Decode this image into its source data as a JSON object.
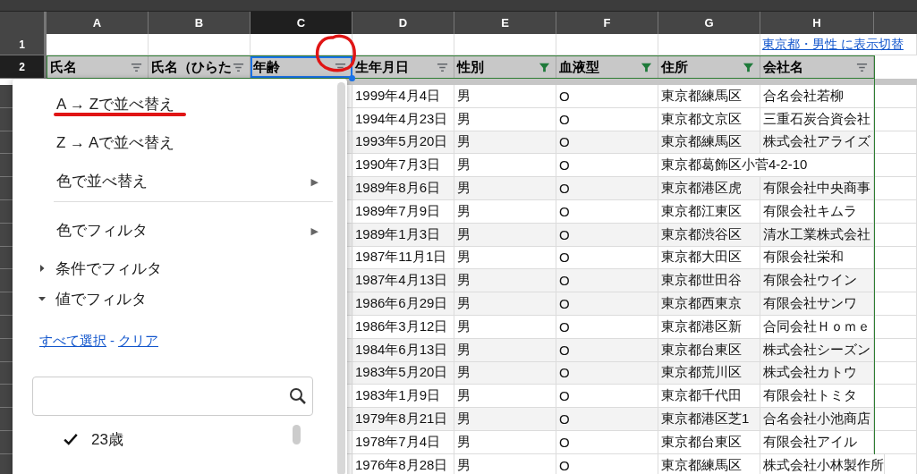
{
  "columns": [
    {
      "letter": "A",
      "selected": false,
      "header": "氏名",
      "filter_active": false
    },
    {
      "letter": "B",
      "selected": false,
      "header": "氏名（ひらた",
      "filter_active": false
    },
    {
      "letter": "C",
      "selected": true,
      "header": "年齢",
      "filter_active": false
    },
    {
      "letter": "D",
      "selected": false,
      "header": "生年月日",
      "filter_active": false
    },
    {
      "letter": "E",
      "selected": false,
      "header": "性別",
      "filter_active": true
    },
    {
      "letter": "F",
      "selected": false,
      "header": "血液型",
      "filter_active": true
    },
    {
      "letter": "G",
      "selected": false,
      "header": "住所",
      "filter_active": true
    },
    {
      "letter": "H",
      "selected": false,
      "header": "会社名",
      "filter_active": false
    }
  ],
  "row_numbers": [
    {
      "label": "1",
      "selected": false
    },
    {
      "label": "2",
      "selected": true
    }
  ],
  "link": "東京都・男性 に表示切替",
  "rows": [
    {
      "shaded": false,
      "cells": [
        "1999年4月4日",
        "男",
        "O",
        "東京都練馬区",
        "合名会社若柳"
      ]
    },
    {
      "shaded": false,
      "cells": [
        "1994年4月23日",
        "男",
        "O",
        "東京都文京区",
        "三重石炭合資会社"
      ]
    },
    {
      "shaded": true,
      "cells": [
        "1993年5月20日",
        "男",
        "O",
        "東京都練馬区",
        "株式会社アライズ"
      ]
    },
    {
      "shaded": false,
      "cells": [
        "1990年7月3日",
        "男",
        "O",
        "東京都葛飾区小菅4-2-10",
        ""
      ]
    },
    {
      "shaded": true,
      "cells": [
        "1989年8月6日",
        "男",
        "O",
        "東京都港区虎",
        "有限会社中央商事"
      ]
    },
    {
      "shaded": false,
      "cells": [
        "1989年7月9日",
        "男",
        "O",
        "東京都江東区",
        "有限会社キムラ"
      ]
    },
    {
      "shaded": true,
      "cells": [
        "1989年1月3日",
        "男",
        "O",
        "東京都渋谷区",
        "清水工業株式会社"
      ]
    },
    {
      "shaded": false,
      "cells": [
        "1987年11月1日",
        "男",
        "O",
        "東京都大田区",
        "有限会社栄和"
      ]
    },
    {
      "shaded": true,
      "cells": [
        "1987年4月13日",
        "男",
        "O",
        "東京都世田谷",
        "有限会社ウイン"
      ]
    },
    {
      "shaded": true,
      "cells": [
        "1986年6月29日",
        "男",
        "O",
        "東京都西東京",
        "有限会社サンワ"
      ]
    },
    {
      "shaded": false,
      "cells": [
        "1986年3月12日",
        "男",
        "O",
        "東京都港区新",
        "合同会社Ｈｏｍｅ"
      ]
    },
    {
      "shaded": true,
      "cells": [
        "1984年6月13日",
        "男",
        "O",
        "東京都台東区",
        "株式会社シーズン"
      ]
    },
    {
      "shaded": true,
      "cells": [
        "1983年5月20日",
        "男",
        "O",
        "東京都荒川区",
        "株式会社カトウ"
      ]
    },
    {
      "shaded": false,
      "cells": [
        "1983年1月9日",
        "男",
        "O",
        "東京都千代田",
        "有限会社トミタ"
      ]
    },
    {
      "shaded": true,
      "cells": [
        "1979年8月21日",
        "男",
        "O",
        "東京都港区芝1",
        "合名会社小池商店"
      ]
    },
    {
      "shaded": false,
      "cells": [
        "1978年7月4日",
        "男",
        "O",
        "東京都台東区",
        "有限会社アイル"
      ]
    },
    {
      "shaded": false,
      "cells": [
        "1976年8月28日",
        "男",
        "O",
        "東京都練馬区",
        "株式会社小林製作所"
      ]
    }
  ],
  "menu": {
    "items": [
      {
        "kind": "action",
        "label": "A → Zで並べ替え"
      },
      {
        "kind": "action",
        "label": "Z → Aで並べ替え"
      },
      {
        "kind": "submenu",
        "label": "色で並べ替え",
        "arrow": "▶"
      },
      {
        "kind": "divider"
      },
      {
        "kind": "submenu",
        "label": "色でフィルタ",
        "arrow": "▶"
      },
      {
        "kind": "section",
        "label": "条件でフィルタ",
        "expanded": false
      },
      {
        "kind": "section",
        "label": "値でフィルタ",
        "expanded": true
      }
    ],
    "select_all": "すべて選択",
    "separator": "-",
    "clear": "クリア",
    "values": [
      {
        "label": "23歳",
        "checked": true
      }
    ]
  }
}
